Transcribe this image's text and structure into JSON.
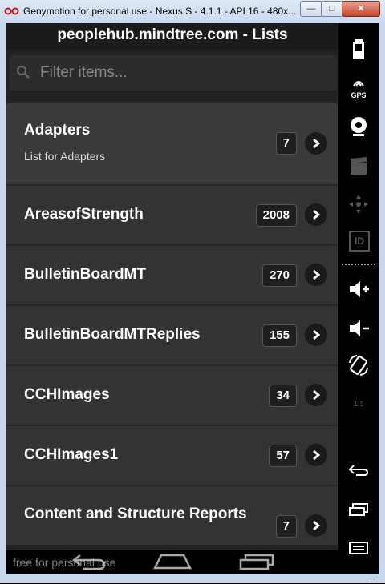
{
  "window": {
    "title": "Genymotion for personal use - Nexus S - 4.1.1 - API 16 - 480x...",
    "min_label": "—",
    "max_label": "□",
    "close_label": "✕"
  },
  "app": {
    "action_bar_title": "peoplehub.mindtree.com - Lists",
    "filter": {
      "placeholder": "Filter items..."
    },
    "items": [
      {
        "label": "Adapters",
        "subtitle": "List for Adapters",
        "count": "7"
      },
      {
        "label": "AreasofStrength",
        "count": "2008"
      },
      {
        "label": "BulletinBoardMT",
        "count": "270"
      },
      {
        "label": "BulletinBoardMTReplies",
        "count": "155"
      },
      {
        "label": "CCHImages",
        "count": "34"
      },
      {
        "label": "CCHImages1",
        "count": "57"
      },
      {
        "label": "Content and Structure Reports",
        "count": "7"
      }
    ]
  },
  "watermark": "free for personal use",
  "side_panel": {
    "buttons": [
      "battery-icon",
      "gps-icon",
      "camera-icon",
      "clapper-icon",
      "dpad-icon",
      "id-icon",
      "volume-up-icon",
      "volume-down-icon",
      "rotate-icon",
      "scale-icon",
      "back-icon",
      "recent-apps-icon",
      "menu-icon"
    ],
    "gps_label": "GPS",
    "id_label": "ID",
    "scale_label": "1:1"
  },
  "colors": {
    "accent": "#ffffff",
    "background": "#222222",
    "item": "#333333"
  }
}
